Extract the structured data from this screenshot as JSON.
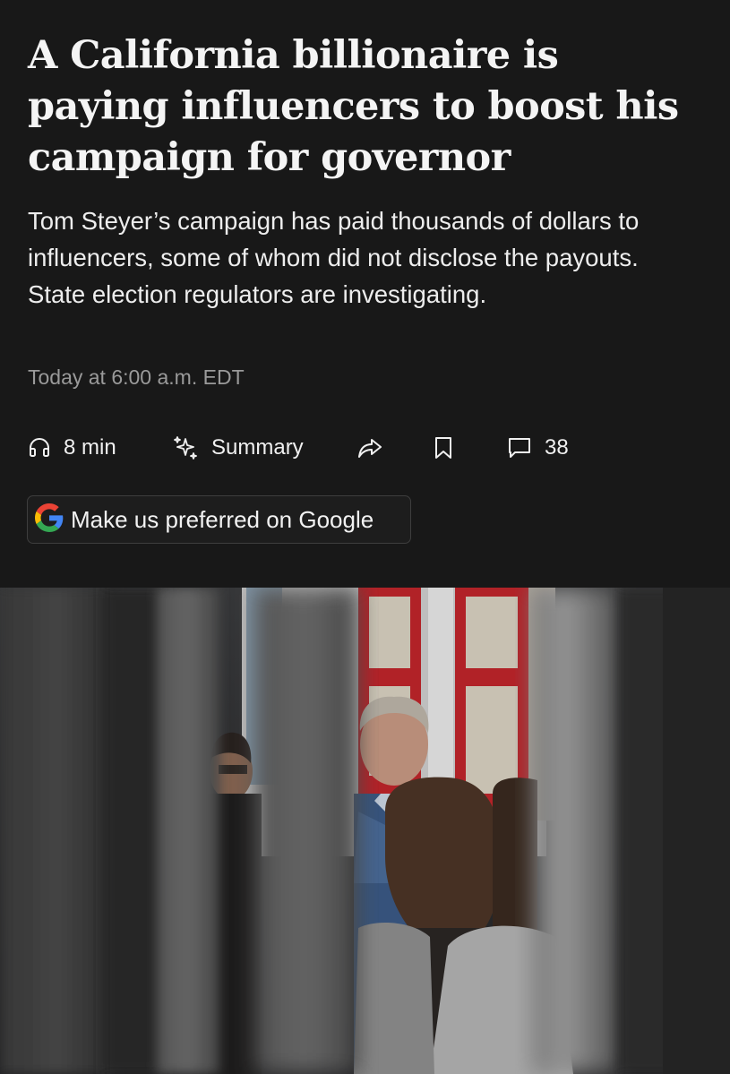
{
  "article": {
    "headline": "A California billionaire is paying influencers to boost his campaign for governor",
    "dek": "Tom Steyer’s campaign has paid thousands of dollars to influencers, some of whom did not disclose the payouts. State election regulators are investigating.",
    "timestamp": "Today at 6:00 a.m. EDT"
  },
  "actions": {
    "listen_label": "8 min",
    "summary_label": "Summary",
    "comments_count": "38",
    "icons": [
      "headphones-icon",
      "sparkle-icon",
      "share-icon",
      "bookmark-icon",
      "comment-icon"
    ]
  },
  "google_pref": {
    "label": "Make us preferred on Google",
    "icon": "google-g-icon"
  },
  "colors": {
    "background": "#181818",
    "text": "#f2f2f2",
    "timestamp": "#9a9a9a",
    "button_border": "#3e3e3e"
  }
}
